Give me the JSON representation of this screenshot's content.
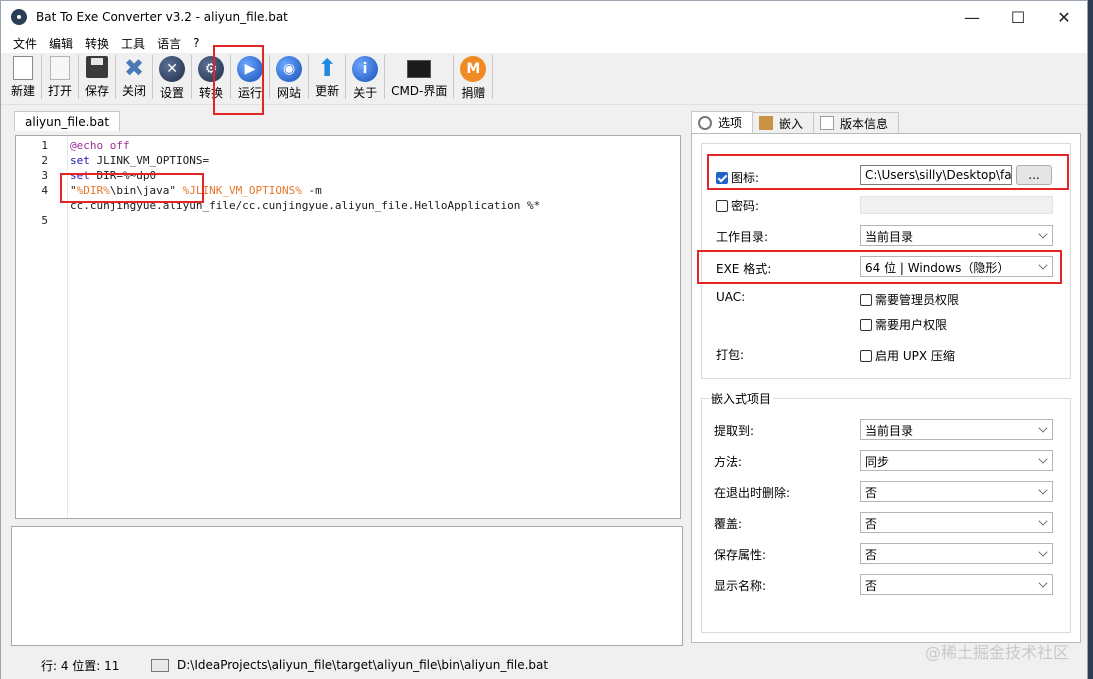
{
  "window": {
    "title": "Bat To Exe Converter v3.2 - aliyun_file.bat",
    "controls": [
      "—",
      "☐",
      "✕"
    ]
  },
  "menu": [
    "文件",
    "编辑",
    "转换",
    "工具",
    "语言",
    "?"
  ],
  "toolbar": {
    "new": "新建",
    "open": "打开",
    "save": "保存",
    "close": "关闭",
    "settings": "设置",
    "convert": "转换",
    "run": "运行",
    "website": "网站",
    "update": "更新",
    "about": "关于",
    "cmd": "CMD-界面",
    "donate": "捐赠"
  },
  "editor": {
    "tab": "aliyun_file.bat",
    "line_numbers": [
      "1",
      "2",
      "3",
      "4",
      "",
      "5"
    ],
    "lines": {
      "l1": "@echo off",
      "l2_kw": "set",
      "l2_rest": " JLINK_VM_OPTIONS=",
      "l3_kw": "set",
      "l3_rest": " DIR=%~dp0",
      "l4_a": "\"",
      "l4_var1": "%DIR%",
      "l4_b": "\\bin\\java\" ",
      "l4_var2": "%JLINK_VM_OPTIONS%",
      "l4_c": " -m",
      "l5": "cc.cunjingyue.aliyun_file/cc.cunjingyue.aliyun_file.HelloApplication %*"
    }
  },
  "tabs": {
    "options": "选项",
    "embed": "嵌入",
    "version": "版本信息"
  },
  "options": {
    "icon_label": "图标:",
    "icon_path": "C:\\Users\\silly\\Desktop\\fa",
    "browse": "...",
    "password_label": "密码:",
    "workdir_label": "工作目录:",
    "workdir_value": "当前目录",
    "exe_label": "EXE 格式:",
    "exe_value": "64 位 | Windows（隐形）",
    "uac_label": "UAC:",
    "uac_admin": "需要管理员权限",
    "uac_user": "需要用户权限",
    "pack_label": "打包:",
    "pack_upx": "启用 UPX 压缩"
  },
  "embedded": {
    "group_title": "嵌入式项目",
    "extract_label": "提取到:",
    "extract_value": "当前目录",
    "method_label": "方法:",
    "method_value": "同步",
    "delete_label": "在退出时删除:",
    "delete_value": "否",
    "overwrite_label": "覆盖:",
    "overwrite_value": "否",
    "attrs_label": "保存属性:",
    "attrs_value": "否",
    "showname_label": "显示名称:",
    "showname_value": "否"
  },
  "status": {
    "position": "行: 4  位置: 11",
    "path": "D:\\IdeaProjects\\aliyun_file\\target\\aliyun_file\\bin\\aliyun_file.bat"
  },
  "watermark": "@稀土掘金技术社区"
}
